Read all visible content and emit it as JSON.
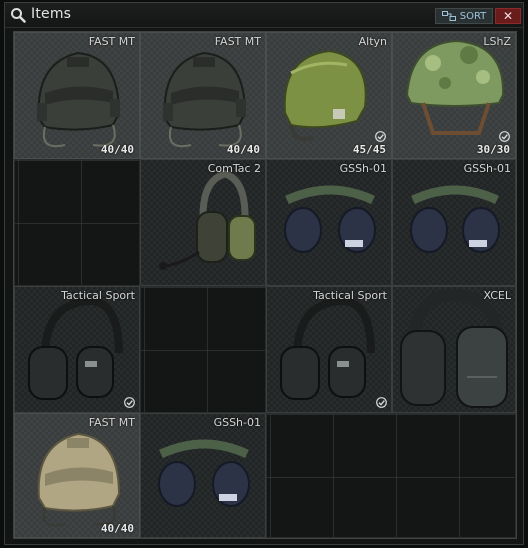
{
  "window": {
    "title": "Items",
    "sort_label": "SORT",
    "close_label": "✕"
  },
  "colors": {
    "accent_sort": "#9fc2d8",
    "close_bg": "#6a1c1c",
    "label": "#d6d6d6"
  },
  "items": [
    {
      "id": "fast-mt-1",
      "name": "FAST MT",
      "durability": "40/40",
      "kind": "helmet-black"
    },
    {
      "id": "fast-mt-2",
      "name": "FAST MT",
      "durability": "40/40",
      "kind": "helmet-black"
    },
    {
      "id": "altyn",
      "name": "Altyn",
      "durability": "45/45",
      "kind": "helmet-green",
      "checked": true
    },
    {
      "id": "lshz",
      "name": "LShZ",
      "durability": "30/30",
      "kind": "helmet-camo",
      "checked": true
    },
    {
      "id": "comtac-2",
      "name": "ComTac 2",
      "kind": "headset-comtac"
    },
    {
      "id": "gssh-1",
      "name": "GSSh-01",
      "kind": "headset-gssh"
    },
    {
      "id": "gssh-2",
      "name": "GSSh-01",
      "kind": "headset-gssh"
    },
    {
      "id": "tactical-sport-1",
      "name": "Tactical Sport",
      "kind": "headset-sport",
      "checked": true
    },
    {
      "id": "tactical-sport-2",
      "name": "Tactical Sport",
      "kind": "headset-sport",
      "checked": true
    },
    {
      "id": "xcel",
      "name": "XCEL",
      "kind": "headset-xcel"
    },
    {
      "id": "fast-mt-tan",
      "name": "FAST MT",
      "durability": "40/40",
      "kind": "helmet-tan"
    },
    {
      "id": "gssh-3",
      "name": "GSSh-01",
      "kind": "headset-gssh"
    }
  ]
}
